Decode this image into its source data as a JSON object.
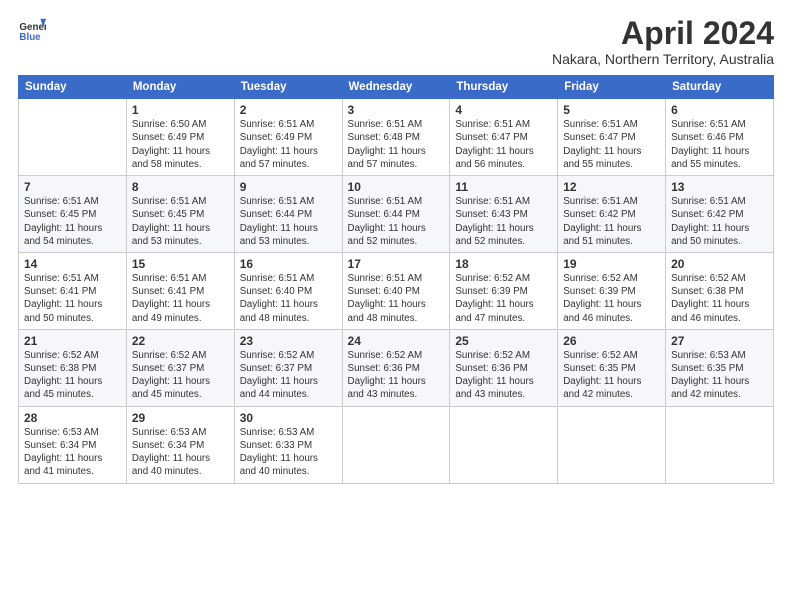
{
  "header": {
    "logo_line1": "General",
    "logo_line2": "Blue",
    "month_title": "April 2024",
    "location": "Nakara, Northern Territory, Australia"
  },
  "weekdays": [
    "Sunday",
    "Monday",
    "Tuesday",
    "Wednesday",
    "Thursday",
    "Friday",
    "Saturday"
  ],
  "weeks": [
    [
      {
        "day": "",
        "text": ""
      },
      {
        "day": "1",
        "text": "Sunrise: 6:50 AM\nSunset: 6:49 PM\nDaylight: 11 hours\nand 58 minutes."
      },
      {
        "day": "2",
        "text": "Sunrise: 6:51 AM\nSunset: 6:49 PM\nDaylight: 11 hours\nand 57 minutes."
      },
      {
        "day": "3",
        "text": "Sunrise: 6:51 AM\nSunset: 6:48 PM\nDaylight: 11 hours\nand 57 minutes."
      },
      {
        "day": "4",
        "text": "Sunrise: 6:51 AM\nSunset: 6:47 PM\nDaylight: 11 hours\nand 56 minutes."
      },
      {
        "day": "5",
        "text": "Sunrise: 6:51 AM\nSunset: 6:47 PM\nDaylight: 11 hours\nand 55 minutes."
      },
      {
        "day": "6",
        "text": "Sunrise: 6:51 AM\nSunset: 6:46 PM\nDaylight: 11 hours\nand 55 minutes."
      }
    ],
    [
      {
        "day": "7",
        "text": "Sunrise: 6:51 AM\nSunset: 6:45 PM\nDaylight: 11 hours\nand 54 minutes."
      },
      {
        "day": "8",
        "text": "Sunrise: 6:51 AM\nSunset: 6:45 PM\nDaylight: 11 hours\nand 53 minutes."
      },
      {
        "day": "9",
        "text": "Sunrise: 6:51 AM\nSunset: 6:44 PM\nDaylight: 11 hours\nand 53 minutes."
      },
      {
        "day": "10",
        "text": "Sunrise: 6:51 AM\nSunset: 6:44 PM\nDaylight: 11 hours\nand 52 minutes."
      },
      {
        "day": "11",
        "text": "Sunrise: 6:51 AM\nSunset: 6:43 PM\nDaylight: 11 hours\nand 52 minutes."
      },
      {
        "day": "12",
        "text": "Sunrise: 6:51 AM\nSunset: 6:42 PM\nDaylight: 11 hours\nand 51 minutes."
      },
      {
        "day": "13",
        "text": "Sunrise: 6:51 AM\nSunset: 6:42 PM\nDaylight: 11 hours\nand 50 minutes."
      }
    ],
    [
      {
        "day": "14",
        "text": "Sunrise: 6:51 AM\nSunset: 6:41 PM\nDaylight: 11 hours\nand 50 minutes."
      },
      {
        "day": "15",
        "text": "Sunrise: 6:51 AM\nSunset: 6:41 PM\nDaylight: 11 hours\nand 49 minutes."
      },
      {
        "day": "16",
        "text": "Sunrise: 6:51 AM\nSunset: 6:40 PM\nDaylight: 11 hours\nand 48 minutes."
      },
      {
        "day": "17",
        "text": "Sunrise: 6:51 AM\nSunset: 6:40 PM\nDaylight: 11 hours\nand 48 minutes."
      },
      {
        "day": "18",
        "text": "Sunrise: 6:52 AM\nSunset: 6:39 PM\nDaylight: 11 hours\nand 47 minutes."
      },
      {
        "day": "19",
        "text": "Sunrise: 6:52 AM\nSunset: 6:39 PM\nDaylight: 11 hours\nand 46 minutes."
      },
      {
        "day": "20",
        "text": "Sunrise: 6:52 AM\nSunset: 6:38 PM\nDaylight: 11 hours\nand 46 minutes."
      }
    ],
    [
      {
        "day": "21",
        "text": "Sunrise: 6:52 AM\nSunset: 6:38 PM\nDaylight: 11 hours\nand 45 minutes."
      },
      {
        "day": "22",
        "text": "Sunrise: 6:52 AM\nSunset: 6:37 PM\nDaylight: 11 hours\nand 45 minutes."
      },
      {
        "day": "23",
        "text": "Sunrise: 6:52 AM\nSunset: 6:37 PM\nDaylight: 11 hours\nand 44 minutes."
      },
      {
        "day": "24",
        "text": "Sunrise: 6:52 AM\nSunset: 6:36 PM\nDaylight: 11 hours\nand 43 minutes."
      },
      {
        "day": "25",
        "text": "Sunrise: 6:52 AM\nSunset: 6:36 PM\nDaylight: 11 hours\nand 43 minutes."
      },
      {
        "day": "26",
        "text": "Sunrise: 6:52 AM\nSunset: 6:35 PM\nDaylight: 11 hours\nand 42 minutes."
      },
      {
        "day": "27",
        "text": "Sunrise: 6:53 AM\nSunset: 6:35 PM\nDaylight: 11 hours\nand 42 minutes."
      }
    ],
    [
      {
        "day": "28",
        "text": "Sunrise: 6:53 AM\nSunset: 6:34 PM\nDaylight: 11 hours\nand 41 minutes."
      },
      {
        "day": "29",
        "text": "Sunrise: 6:53 AM\nSunset: 6:34 PM\nDaylight: 11 hours\nand 40 minutes."
      },
      {
        "day": "30",
        "text": "Sunrise: 6:53 AM\nSunset: 6:33 PM\nDaylight: 11 hours\nand 40 minutes."
      },
      {
        "day": "",
        "text": ""
      },
      {
        "day": "",
        "text": ""
      },
      {
        "day": "",
        "text": ""
      },
      {
        "day": "",
        "text": ""
      }
    ]
  ]
}
